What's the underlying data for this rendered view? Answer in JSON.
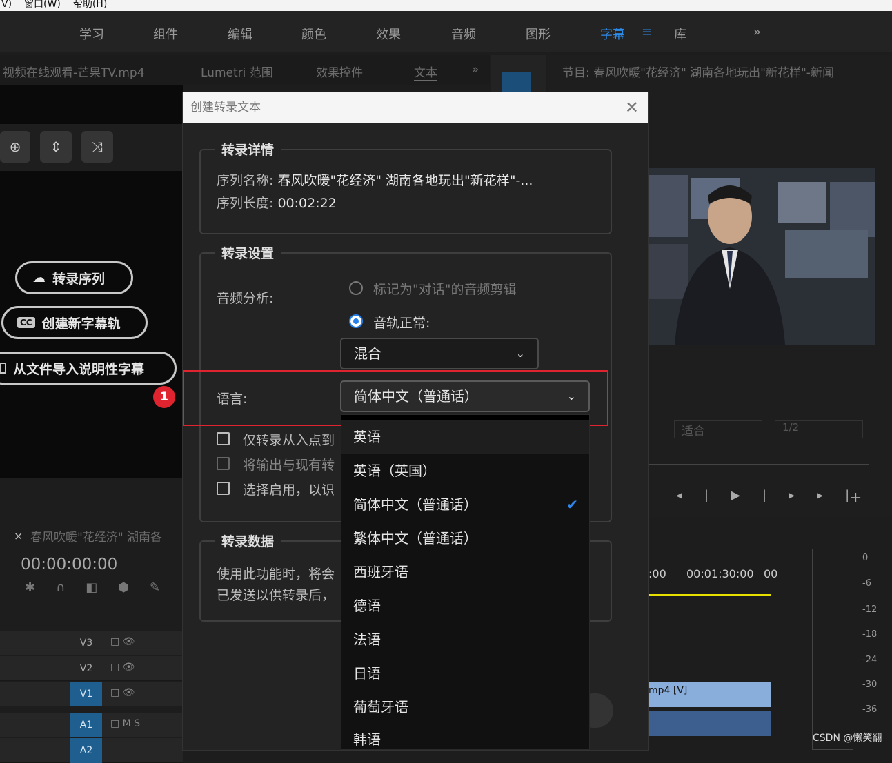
{
  "menubar": {
    "items": [
      "V)",
      "窗口(W)",
      "帮助(H)"
    ]
  },
  "workspace": {
    "tabs": [
      "学习",
      "组件",
      "编辑",
      "颜色",
      "效果",
      "音频",
      "图形",
      "字幕",
      "库"
    ],
    "active": "字幕",
    "menu_icon": "≡",
    "overflow": "»"
  },
  "left_panel": {
    "tabs": [
      "视频在线观看-芒果TV.mp4",
      "Lumetri 范围",
      "效果控件",
      "文本"
    ],
    "overflow": "»",
    "buttons": {
      "transcribe": "转录序列",
      "new_caption_track": "创建新字幕轨",
      "import_captions": "从文件导入说明性字幕"
    },
    "badge": "1"
  },
  "program_monitor": {
    "title": "节目: 春风吹暖\"花经济\" 湖南各地玩出\"新花样\"-新闻",
    "fit": "适合",
    "resolution": "1/2"
  },
  "timeline": {
    "sequence_tab": "春风吹暖\"花经济\" 湖南各",
    "close": "×",
    "timecode": "00:00:00:00",
    "ruler": [
      ":00",
      "00:01:30:00",
      "00"
    ],
    "tracks": [
      {
        "name": "V3",
        "active": false
      },
      {
        "name": "V2",
        "active": false
      },
      {
        "name": "V1",
        "active": true
      },
      {
        "name": "A1",
        "active": true
      },
      {
        "name": "A2",
        "active": true
      }
    ],
    "clip_label": "mp4 [V]",
    "meter_scale": [
      "0",
      "-6",
      "-12",
      "-18",
      "-24",
      "-30",
      "-36"
    ]
  },
  "dialog": {
    "title": "创建转录文本",
    "details": {
      "heading": "转录详情",
      "seq_name_label": "序列名称:",
      "seq_name_value": "春风吹暖\"花经济\" 湖南各地玩出\"新花样\"-...",
      "seq_len_label": "序列长度:",
      "seq_len_value": "00:02:22"
    },
    "settings": {
      "heading": "转录设置",
      "audio_label": "音频分析:",
      "radio_dialog": "标记为\"对话\"的音频剪辑",
      "radio_track": "音轨正常:",
      "track_value": "混合",
      "language_label": "语言:",
      "language_value": "简体中文（普通话）",
      "cb1": "仅转录从入点到",
      "cb2": "将输出与现有转",
      "cb3": "选择启用，以识"
    },
    "data": {
      "heading": "转录数据",
      "line1": "使用此功能时，将会",
      "line2": "已发送以供转录后，"
    },
    "dropdown_options": [
      "英语",
      "英语（英国）",
      "简体中文（普通话）",
      "繁体中文（普通话）",
      "西班牙语",
      "德语",
      "法语",
      "日语",
      "葡萄牙语",
      "韩语"
    ],
    "selected_option": "简体中文（普通话）"
  },
  "watermark": "CSDN @懒笑翻",
  "colors": {
    "accent": "#2d8ceb",
    "highlight_box": "#e0242f",
    "badge": "#e0242f"
  }
}
